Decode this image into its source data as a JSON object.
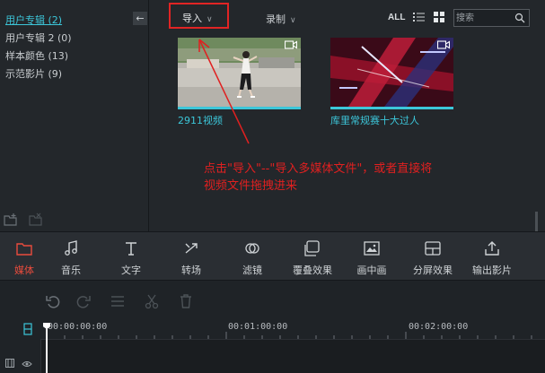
{
  "sidebar": {
    "items": [
      {
        "label": "用户专辑 (2)",
        "active": true
      },
      {
        "label": "用户专辑 2 (0)",
        "active": false
      },
      {
        "label": "样本颜色 (13)",
        "active": false
      },
      {
        "label": "示范影片 (9)",
        "active": false
      }
    ],
    "collapse_icon": "arrow-left-icon",
    "bottom_icons": [
      "add-folder-icon",
      "remove-folder-icon"
    ]
  },
  "toolbar": {
    "import_label": "导入",
    "record_label": "录制",
    "all_label": "ALL",
    "search_placeholder": "搜索"
  },
  "media": [
    {
      "label": "2911视频",
      "badge": "video-camera-icon"
    },
    {
      "label": "库里常规赛十大过人",
      "badge": "video-camera-icon"
    }
  ],
  "annotation": {
    "text": "点击\"导入\"--\"导入多媒体文件\"，或者直接将视频文件拖拽进来",
    "color": "#e02020"
  },
  "tools": [
    {
      "label": "媒体",
      "icon": "folder-icon",
      "active": true
    },
    {
      "label": "音乐",
      "icon": "music-note-icon",
      "active": false
    },
    {
      "label": "文字",
      "icon": "text-icon",
      "active": false
    },
    {
      "label": "转场",
      "icon": "transition-icon",
      "active": false
    },
    {
      "label": "滤镜",
      "icon": "filter-icon",
      "active": false
    },
    {
      "label": "覆叠效果",
      "icon": "overlay-icon",
      "active": false
    },
    {
      "label": "画中画",
      "icon": "picture-in-picture-icon",
      "active": false
    },
    {
      "label": "分屏效果",
      "icon": "split-screen-icon",
      "active": false
    },
    {
      "label": "输出影片",
      "icon": "export-icon",
      "active": false
    }
  ],
  "timeline": {
    "buttons": [
      "undo-icon",
      "redo-icon",
      "adjust-icon",
      "cut-icon",
      "delete-icon"
    ],
    "ticks": [
      "00:00:00:00",
      "00:01:00:00",
      "00:02:00:00"
    ]
  },
  "colors": {
    "accent": "#3cc6d9",
    "active_tool": "#e94c3d",
    "highlight_box": "#e12424",
    "background": "#23272b"
  }
}
